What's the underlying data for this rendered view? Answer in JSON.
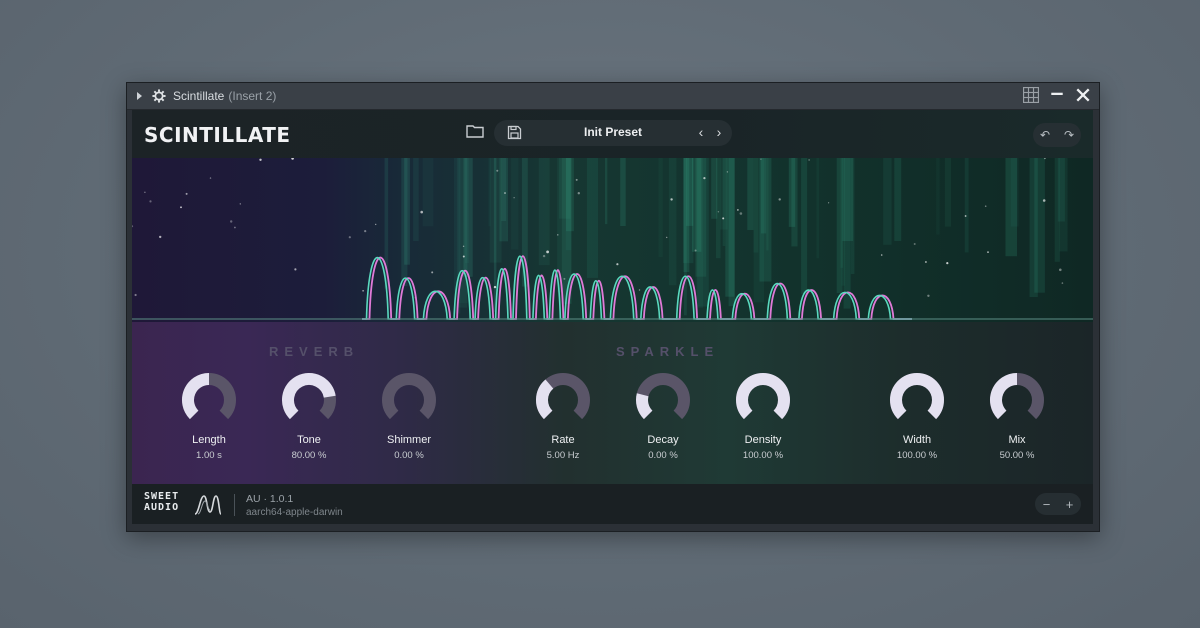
{
  "window": {
    "title": "Scintillate",
    "subtitle": "(Insert 2)"
  },
  "header": {
    "logo": "SCINTILLATE",
    "preset_name": "Init Preset",
    "prev_label": "‹",
    "next_label": "›",
    "undo_label": "↶",
    "redo_label": "↷"
  },
  "sections": [
    {
      "title": "REVERB"
    },
    {
      "title": "SPARKLE"
    }
  ],
  "knobs": [
    {
      "label": "Length",
      "value": "1.00 s",
      "level": 0.5
    },
    {
      "label": "Tone",
      "value": "80.00 %",
      "level": 0.8
    },
    {
      "label": "Shimmer",
      "value": "0.00 %",
      "level": 0.0
    },
    {
      "label": "Rate",
      "value": "5.00 Hz",
      "level": 0.35
    },
    {
      "label": "Decay",
      "value": "0.00 %",
      "level": 0.22
    },
    {
      "label": "Density",
      "value": "100.00 %",
      "level": 1.0
    },
    {
      "label": "Width",
      "value": "100.00 %",
      "level": 1.0
    },
    {
      "label": "Mix",
      "value": "50.00 %",
      "level": 0.5
    }
  ],
  "footer": {
    "brand_top": "SWEET",
    "brand_bottom": "AUDIO",
    "version": "AU · 1.0.1",
    "arch": "aarch64-apple-darwin",
    "zoom_out": "−",
    "zoom_in": "+"
  },
  "colors": {
    "knob_fill": "#e4e1f0",
    "knob_track": "#5a5568",
    "spectrum_pink": "#e07ad8",
    "spectrum_teal": "#5ad9bf"
  }
}
